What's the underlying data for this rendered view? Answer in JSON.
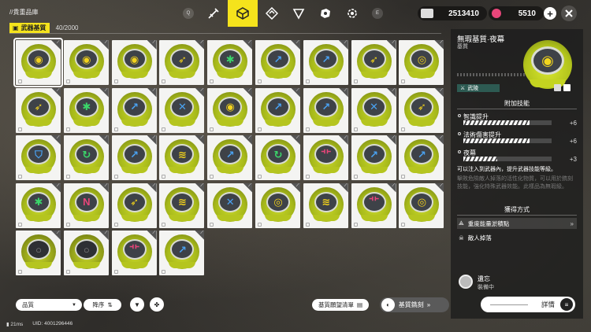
{
  "header": {
    "breadcrumb": "//貴重品庫",
    "key_left": "Q",
    "key_right": "E",
    "tabs": [
      {
        "icon": "weapon-icon",
        "active": false
      },
      {
        "icon": "essence-cube-icon",
        "active": true
      },
      {
        "icon": "diamond-arrow-icon",
        "active": false
      },
      {
        "icon": "shield-down-icon",
        "active": false
      },
      {
        "icon": "cube-pack-icon",
        "active": false
      },
      {
        "icon": "gear-ring-icon",
        "active": false
      }
    ],
    "currency1": "2513410",
    "currency2": "5510"
  },
  "inventory": {
    "tag_label": "武器基質",
    "count": "40/2000"
  },
  "items": [
    {
      "sym": "◉",
      "color": "#f2d21c",
      "ring": "yellow",
      "selected": true
    },
    {
      "sym": "◉",
      "color": "#f2d21c",
      "ring": "yellow"
    },
    {
      "sym": "◉",
      "color": "#f2d21c",
      "ring": "yellow"
    },
    {
      "sym": "➶",
      "color": "#f2d21c",
      "ring": "yellow"
    },
    {
      "sym": "✱",
      "color": "#3bd66a",
      "ring": "yellow"
    },
    {
      "sym": "↗",
      "color": "#4aa2f2",
      "ring": "yellow"
    },
    {
      "sym": "↗",
      "color": "#4aa2f2",
      "ring": "yellow"
    },
    {
      "sym": "➶",
      "color": "#f2d21c",
      "ring": "yellow"
    },
    {
      "sym": "◎",
      "color": "#f2d21c",
      "ring": "yellow"
    },
    {
      "sym": "➶",
      "color": "#f2d21c",
      "ring": "yellow"
    },
    {
      "sym": "✱",
      "color": "#3bd66a",
      "ring": "yellow"
    },
    {
      "sym": "↗",
      "color": "#4aa2f2",
      "ring": "yellow"
    },
    {
      "sym": "✕",
      "color": "#4aa2f2",
      "ring": "yellow"
    },
    {
      "sym": "◉",
      "color": "#f2d21c",
      "ring": "yellow"
    },
    {
      "sym": "↗",
      "color": "#4aa2f2",
      "ring": "yellow"
    },
    {
      "sym": "↗",
      "color": "#4aa2f2",
      "ring": "yellow"
    },
    {
      "sym": "✕",
      "color": "#4aa2f2",
      "ring": "yellow"
    },
    {
      "sym": "➶",
      "color": "#f2d21c",
      "ring": "yellow"
    },
    {
      "sym": "⛉",
      "color": "#4aa2f2",
      "ring": "yellow"
    },
    {
      "sym": "↻",
      "color": "#3bd66a",
      "ring": "yellow"
    },
    {
      "sym": "↗",
      "color": "#4aa2f2",
      "ring": "yellow"
    },
    {
      "sym": "≋",
      "color": "#f2d21c",
      "ring": "yellow"
    },
    {
      "sym": "↗",
      "color": "#4aa2f2",
      "ring": "yellow"
    },
    {
      "sym": "↻",
      "color": "#3bd66a",
      "ring": "yellow"
    },
    {
      "sym": "⻀",
      "color": "#e8467a",
      "ring": "yellow"
    },
    {
      "sym": "↗",
      "color": "#4aa2f2",
      "ring": "yellow"
    },
    {
      "sym": "↗",
      "color": "#4aa2f2",
      "ring": "yellow"
    },
    {
      "sym": "✱",
      "color": "#3bd66a",
      "ring": "yellow"
    },
    {
      "sym": "N",
      "color": "#e8467a",
      "ring": "yellow"
    },
    {
      "sym": "➶",
      "color": "#f2d21c",
      "ring": "yellow"
    },
    {
      "sym": "≋",
      "color": "#f2d21c",
      "ring": "yellow"
    },
    {
      "sym": "✕",
      "color": "#4aa2f2",
      "ring": "yellow"
    },
    {
      "sym": "◎",
      "color": "#f2d21c",
      "ring": "yellow"
    },
    {
      "sym": "≋",
      "color": "#f2d21c",
      "ring": "yellow"
    },
    {
      "sym": "⻀",
      "color": "#e8467a",
      "ring": "yellow"
    },
    {
      "sym": "◎",
      "color": "#f2d21c",
      "ring": "yellow"
    },
    {
      "sym": "○",
      "color": "#8a8a8a",
      "ring": "gray"
    },
    {
      "sym": "○",
      "color": "#8a8a8a",
      "ring": "gray"
    },
    {
      "sym": "⻀",
      "color": "#e8467a",
      "ring": "yellow"
    },
    {
      "sym": "↗",
      "color": "#4aa2f2",
      "ring": "yellow"
    }
  ],
  "detail": {
    "title": "無瑕基質·夜幕",
    "subtitle": "基質",
    "weapon_type": "武陵",
    "skills_heading": "附加技能",
    "skills": [
      {
        "name": "智識提升",
        "value": "+6",
        "level": 0.75
      },
      {
        "name": "法術傷害提升",
        "value": "+6",
        "level": 0.75
      },
      {
        "name": "夜幕",
        "value": "+3",
        "level": 0.38
      }
    ],
    "description": "可以注入到武器內，提升武器技能等級。",
    "flavor": "擊敗危險敵人掉落的活性化物質，可以用於鐫刻技能，強化特殊武器效能。此樣品為無瑕級。",
    "source_heading": "獲得方式",
    "sources": [
      "重度能量淤積點",
      "敵人掉落"
    ],
    "equipped_name": "遺忘",
    "equipped_status": "裝備中",
    "detail_button": "詳情"
  },
  "bottom": {
    "sort_label": "品質",
    "order_label": "降序",
    "wish_label": "基質願望清單",
    "engrave_label": "基質鐫刻"
  },
  "status": {
    "ping": "21ms",
    "uid": "UID: 4001296446"
  }
}
